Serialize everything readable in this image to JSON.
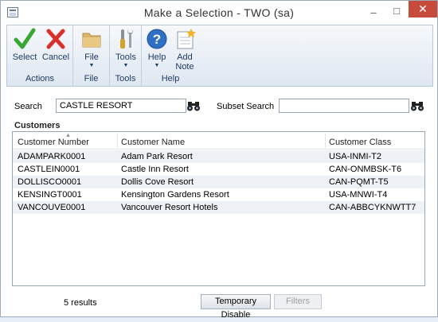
{
  "window": {
    "title": "Make a Selection  -  TWO (sa)"
  },
  "ribbon": {
    "groups": [
      {
        "label": "Actions",
        "buttons": [
          {
            "label": "Select",
            "icon": "checkmark-icon"
          },
          {
            "label": "Cancel",
            "icon": "x-icon"
          }
        ]
      },
      {
        "label": "File",
        "buttons": [
          {
            "label": "File",
            "icon": "folder-icon"
          }
        ]
      },
      {
        "label": "Tools",
        "buttons": [
          {
            "label": "Tools",
            "icon": "tools-icon"
          }
        ]
      },
      {
        "label": "Help",
        "buttons": [
          {
            "label": "Help",
            "icon": "help-icon"
          },
          {
            "label": "Add",
            "label2": "Note",
            "icon": "note-icon"
          }
        ]
      }
    ]
  },
  "search": {
    "label": "Search",
    "value": "CASTLE RESORT"
  },
  "subset_search": {
    "label": "Subset Search",
    "value": ""
  },
  "customers": {
    "title": "Customers",
    "columns": [
      "Customer Number",
      "Customer Name",
      "Customer Class"
    ],
    "rows": [
      [
        "ADAMPARK0001",
        "Adam Park Resort",
        "USA-INMI-T2"
      ],
      [
        "CASTLEIN0001",
        "Castle Inn Resort",
        "CAN-ONMBSK-T6"
      ],
      [
        "DOLLISCO0001",
        "Dollis Cove Resort",
        "CAN-PQMT-T5"
      ],
      [
        "KENSINGT0001",
        "Kensington Gardens Resort",
        "USA-MNWI-T4"
      ],
      [
        "VANCOUVE0001",
        "Vancouver Resort Hotels",
        "CAN-ABBCYKNWTT7"
      ]
    ]
  },
  "footer": {
    "results": "5 results",
    "temporary_disable": "Temporary Disable",
    "filters": "Filters"
  },
  "colors": {
    "accent": "#1f3b64",
    "close": "#c74b3b",
    "check": "#3aa635",
    "cancel": "#d9302b"
  }
}
